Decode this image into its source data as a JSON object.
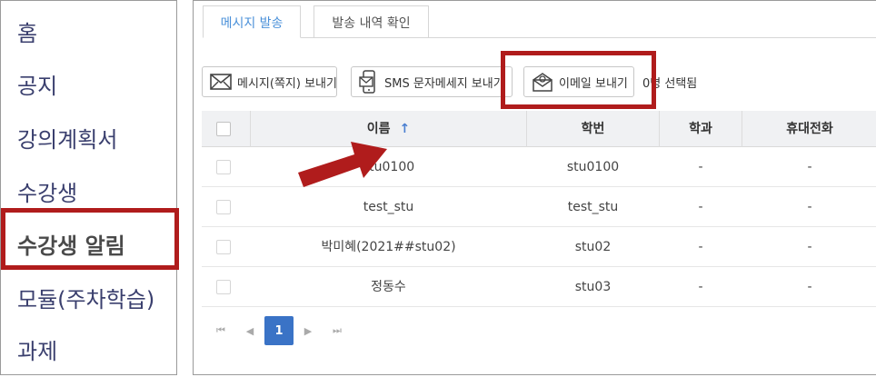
{
  "sidebar": {
    "items": [
      {
        "label": "홈"
      },
      {
        "label": "공지"
      },
      {
        "label": "강의계획서"
      },
      {
        "label": "수강생"
      },
      {
        "label": "수강생 알림"
      },
      {
        "label": "모듈(주차학습)"
      },
      {
        "label": "과제"
      }
    ],
    "active_index": 4
  },
  "tabs": [
    {
      "label": "메시지 발송",
      "active": true
    },
    {
      "label": "발송 내역 확인",
      "active": false
    }
  ],
  "toolbar": {
    "message_button": "메시지(쪽지) 보내기",
    "sms_button": "SMS 문자메세지 보내기",
    "email_button": "이메일 보내기",
    "selected_count": "0명 선택됨"
  },
  "table": {
    "columns": [
      "이름",
      "학번",
      "학과",
      "휴대전화"
    ],
    "sort_indicator": "↑",
    "rows": [
      {
        "name": "stu0100",
        "id": "stu0100",
        "dept": "-",
        "phone": "-"
      },
      {
        "name": "test_stu",
        "id": "test_stu",
        "dept": "-",
        "phone": "-"
      },
      {
        "name": "박미혜(2021##stu02)",
        "id": "stu02",
        "dept": "-",
        "phone": "-"
      },
      {
        "name": "정동수",
        "id": "stu03",
        "dept": "-",
        "phone": "-"
      }
    ]
  },
  "pagination": {
    "first": "⏮",
    "prev": "◀",
    "current": "1",
    "next": "▶",
    "last": "⏭"
  },
  "colors": {
    "highlight": "#b01c1c",
    "accent": "#3a73c6",
    "active_tab": "#4a90d9",
    "sidebar_text": "#3a3f6e"
  }
}
